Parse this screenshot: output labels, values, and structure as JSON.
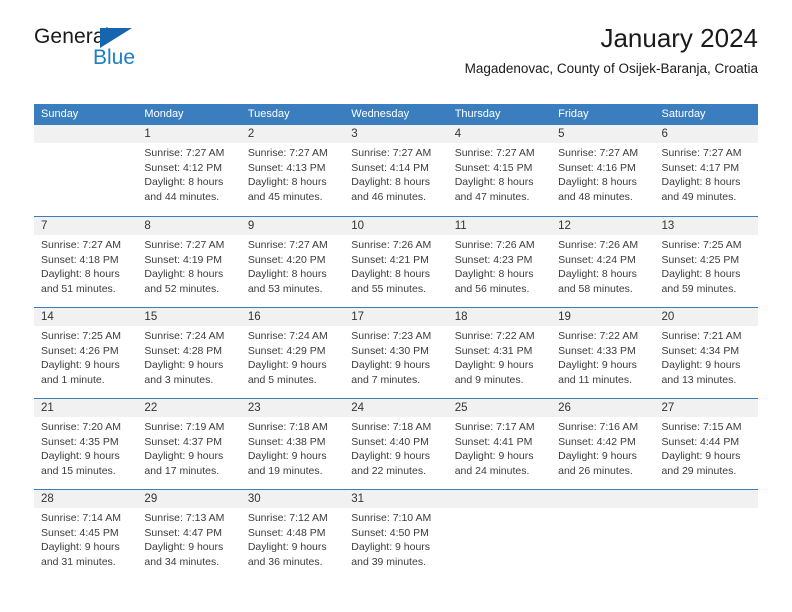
{
  "brand": {
    "name_top": "General",
    "name_bottom": "Blue",
    "triangle_icon": "brand-triangle-icon",
    "color_blue": "#1f7fc4",
    "color_triangle": "#1565b0"
  },
  "header": {
    "title": "January 2024",
    "subtitle": "Magadenovac, County of Osijek-Baranja, Croatia"
  },
  "theme": {
    "header_blue": "#3a7ebf",
    "day_band_gray": "#f1f1f1",
    "text": "#3c3c3c"
  },
  "weekdays": [
    "Sunday",
    "Monday",
    "Tuesday",
    "Wednesday",
    "Thursday",
    "Friday",
    "Saturday"
  ],
  "weeks": [
    [
      {
        "day": "",
        "lines": []
      },
      {
        "day": "1",
        "lines": [
          "Sunrise: 7:27 AM",
          "Sunset: 4:12 PM",
          "Daylight: 8 hours",
          "and 44 minutes."
        ]
      },
      {
        "day": "2",
        "lines": [
          "Sunrise: 7:27 AM",
          "Sunset: 4:13 PM",
          "Daylight: 8 hours",
          "and 45 minutes."
        ]
      },
      {
        "day": "3",
        "lines": [
          "Sunrise: 7:27 AM",
          "Sunset: 4:14 PM",
          "Daylight: 8 hours",
          "and 46 minutes."
        ]
      },
      {
        "day": "4",
        "lines": [
          "Sunrise: 7:27 AM",
          "Sunset: 4:15 PM",
          "Daylight: 8 hours",
          "and 47 minutes."
        ]
      },
      {
        "day": "5",
        "lines": [
          "Sunrise: 7:27 AM",
          "Sunset: 4:16 PM",
          "Daylight: 8 hours",
          "and 48 minutes."
        ]
      },
      {
        "day": "6",
        "lines": [
          "Sunrise: 7:27 AM",
          "Sunset: 4:17 PM",
          "Daylight: 8 hours",
          "and 49 minutes."
        ]
      }
    ],
    [
      {
        "day": "7",
        "lines": [
          "Sunrise: 7:27 AM",
          "Sunset: 4:18 PM",
          "Daylight: 8 hours",
          "and 51 minutes."
        ]
      },
      {
        "day": "8",
        "lines": [
          "Sunrise: 7:27 AM",
          "Sunset: 4:19 PM",
          "Daylight: 8 hours",
          "and 52 minutes."
        ]
      },
      {
        "day": "9",
        "lines": [
          "Sunrise: 7:27 AM",
          "Sunset: 4:20 PM",
          "Daylight: 8 hours",
          "and 53 minutes."
        ]
      },
      {
        "day": "10",
        "lines": [
          "Sunrise: 7:26 AM",
          "Sunset: 4:21 PM",
          "Daylight: 8 hours",
          "and 55 minutes."
        ]
      },
      {
        "day": "11",
        "lines": [
          "Sunrise: 7:26 AM",
          "Sunset: 4:23 PM",
          "Daylight: 8 hours",
          "and 56 minutes."
        ]
      },
      {
        "day": "12",
        "lines": [
          "Sunrise: 7:26 AM",
          "Sunset: 4:24 PM",
          "Daylight: 8 hours",
          "and 58 minutes."
        ]
      },
      {
        "day": "13",
        "lines": [
          "Sunrise: 7:25 AM",
          "Sunset: 4:25 PM",
          "Daylight: 8 hours",
          "and 59 minutes."
        ]
      }
    ],
    [
      {
        "day": "14",
        "lines": [
          "Sunrise: 7:25 AM",
          "Sunset: 4:26 PM",
          "Daylight: 9 hours",
          "and 1 minute."
        ]
      },
      {
        "day": "15",
        "lines": [
          "Sunrise: 7:24 AM",
          "Sunset: 4:28 PM",
          "Daylight: 9 hours",
          "and 3 minutes."
        ]
      },
      {
        "day": "16",
        "lines": [
          "Sunrise: 7:24 AM",
          "Sunset: 4:29 PM",
          "Daylight: 9 hours",
          "and 5 minutes."
        ]
      },
      {
        "day": "17",
        "lines": [
          "Sunrise: 7:23 AM",
          "Sunset: 4:30 PM",
          "Daylight: 9 hours",
          "and 7 minutes."
        ]
      },
      {
        "day": "18",
        "lines": [
          "Sunrise: 7:22 AM",
          "Sunset: 4:31 PM",
          "Daylight: 9 hours",
          "and 9 minutes."
        ]
      },
      {
        "day": "19",
        "lines": [
          "Sunrise: 7:22 AM",
          "Sunset: 4:33 PM",
          "Daylight: 9 hours",
          "and 11 minutes."
        ]
      },
      {
        "day": "20",
        "lines": [
          "Sunrise: 7:21 AM",
          "Sunset: 4:34 PM",
          "Daylight: 9 hours",
          "and 13 minutes."
        ]
      }
    ],
    [
      {
        "day": "21",
        "lines": [
          "Sunrise: 7:20 AM",
          "Sunset: 4:35 PM",
          "Daylight: 9 hours",
          "and 15 minutes."
        ]
      },
      {
        "day": "22",
        "lines": [
          "Sunrise: 7:19 AM",
          "Sunset: 4:37 PM",
          "Daylight: 9 hours",
          "and 17 minutes."
        ]
      },
      {
        "day": "23",
        "lines": [
          "Sunrise: 7:18 AM",
          "Sunset: 4:38 PM",
          "Daylight: 9 hours",
          "and 19 minutes."
        ]
      },
      {
        "day": "24",
        "lines": [
          "Sunrise: 7:18 AM",
          "Sunset: 4:40 PM",
          "Daylight: 9 hours",
          "and 22 minutes."
        ]
      },
      {
        "day": "25",
        "lines": [
          "Sunrise: 7:17 AM",
          "Sunset: 4:41 PM",
          "Daylight: 9 hours",
          "and 24 minutes."
        ]
      },
      {
        "day": "26",
        "lines": [
          "Sunrise: 7:16 AM",
          "Sunset: 4:42 PM",
          "Daylight: 9 hours",
          "and 26 minutes."
        ]
      },
      {
        "day": "27",
        "lines": [
          "Sunrise: 7:15 AM",
          "Sunset: 4:44 PM",
          "Daylight: 9 hours",
          "and 29 minutes."
        ]
      }
    ],
    [
      {
        "day": "28",
        "lines": [
          "Sunrise: 7:14 AM",
          "Sunset: 4:45 PM",
          "Daylight: 9 hours",
          "and 31 minutes."
        ]
      },
      {
        "day": "29",
        "lines": [
          "Sunrise: 7:13 AM",
          "Sunset: 4:47 PM",
          "Daylight: 9 hours",
          "and 34 minutes."
        ]
      },
      {
        "day": "30",
        "lines": [
          "Sunrise: 7:12 AM",
          "Sunset: 4:48 PM",
          "Daylight: 9 hours",
          "and 36 minutes."
        ]
      },
      {
        "day": "31",
        "lines": [
          "Sunrise: 7:10 AM",
          "Sunset: 4:50 PM",
          "Daylight: 9 hours",
          "and 39 minutes."
        ]
      },
      {
        "day": "",
        "lines": []
      },
      {
        "day": "",
        "lines": []
      },
      {
        "day": "",
        "lines": []
      }
    ]
  ]
}
